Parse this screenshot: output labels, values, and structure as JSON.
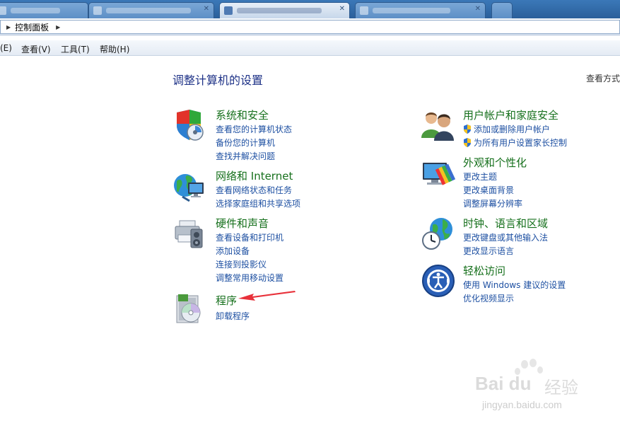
{
  "address_bar": {
    "breadcrumb": "控制面板"
  },
  "menubar": {
    "edit": "(E)",
    "view": "查看(V)",
    "tools": "工具(T)",
    "help": "帮助(H)"
  },
  "page": {
    "title": "调整计算机的设置",
    "view_by": "查看方式"
  },
  "categories_left": [
    {
      "title": "系统和安全",
      "links": [
        "查看您的计算机状态",
        "备份您的计算机",
        "查找并解决问题"
      ]
    },
    {
      "title": "网络和 Internet",
      "links": [
        "查看网络状态和任务",
        "选择家庭组和共享选项"
      ]
    },
    {
      "title": "硬件和声音",
      "links": [
        "查看设备和打印机",
        "添加设备",
        "连接到投影仪",
        "调整常用移动设置"
      ]
    },
    {
      "title": "程序",
      "links": [
        "卸载程序"
      ]
    }
  ],
  "categories_right": [
    {
      "title": "用户帐户和家庭安全",
      "links": [
        "添加或删除用户帐户",
        "为所有用户设置家长控制"
      ]
    },
    {
      "title": "外观和个性化",
      "links": [
        "更改主题",
        "更改桌面背景",
        "调整屏幕分辨率"
      ]
    },
    {
      "title": "时钟、语言和区域",
      "links": [
        "更改键盘或其他输入法",
        "更改显示语言"
      ]
    },
    {
      "title": "轻松访问",
      "links": [
        "使用 Windows 建议的设置",
        "优化视频显示"
      ]
    }
  ],
  "watermark": {
    "brand": "Bai du",
    "jingyan": "经验",
    "url": "jingyan.baidu.com"
  },
  "colors": {
    "category_title": "#16701c",
    "link": "#1e50a2",
    "page_title": "#1e3287",
    "annotation_arrow": "#e8313a"
  }
}
